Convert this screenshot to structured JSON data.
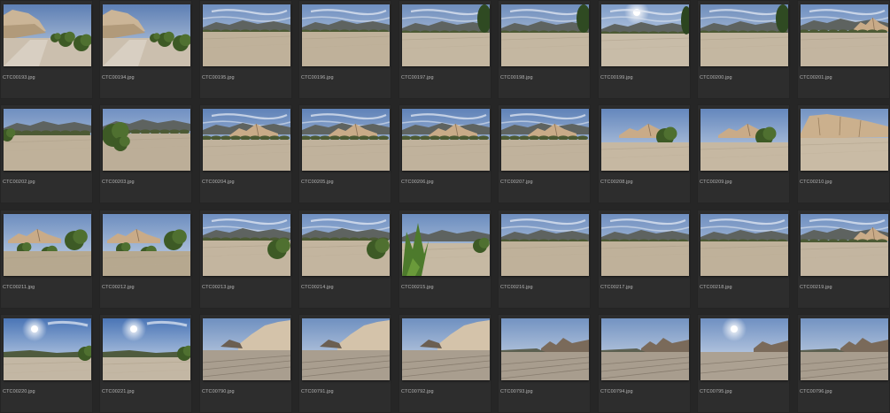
{
  "browser": {
    "thumbnails": [
      {
        "filename": "CTC00193.jpg",
        "scene": "cliffs-trail"
      },
      {
        "filename": "CTC00194.jpg",
        "scene": "cliffs-trail"
      },
      {
        "filename": "CTC00195.jpg",
        "scene": "wash-hills"
      },
      {
        "filename": "CTC00196.jpg",
        "scene": "wash-hills"
      },
      {
        "filename": "CTC00197.jpg",
        "scene": "wash-tree"
      },
      {
        "filename": "CTC00198.jpg",
        "scene": "wash-tree"
      },
      {
        "filename": "CTC00199.jpg",
        "scene": "sun-wash"
      },
      {
        "filename": "CTC00200.jpg",
        "scene": "wash-tree"
      },
      {
        "filename": "CTC00201.jpg",
        "scene": "wash-rocks-right"
      },
      {
        "filename": "CTC00202.jpg",
        "scene": "wash-shrubs"
      },
      {
        "filename": "CTC00203.jpg",
        "scene": "wash-bush-left"
      },
      {
        "filename": "CTC00204.jpg",
        "scene": "rocks-center"
      },
      {
        "filename": "CTC00205.jpg",
        "scene": "rocks-center"
      },
      {
        "filename": "CTC00206.jpg",
        "scene": "rocks-center"
      },
      {
        "filename": "CTC00207.jpg",
        "scene": "rocks-center"
      },
      {
        "filename": "CTC00208.jpg",
        "scene": "rocks-bush"
      },
      {
        "filename": "CTC00209.jpg",
        "scene": "rocks-bush"
      },
      {
        "filename": "CTC00210.jpg",
        "scene": "cliffs-wide"
      },
      {
        "filename": "CTC00211.jpg",
        "scene": "rocks-brush"
      },
      {
        "filename": "CTC00212.jpg",
        "scene": "rocks-brush"
      },
      {
        "filename": "CTC00213.jpg",
        "scene": "wash-bush-right"
      },
      {
        "filename": "CTC00214.jpg",
        "scene": "wash-bush-right"
      },
      {
        "filename": "CTC00215.jpg",
        "scene": "leaves-closeup"
      },
      {
        "filename": "CTC00216.jpg",
        "scene": "wash-hills"
      },
      {
        "filename": "CTC00217.jpg",
        "scene": "wash-hills"
      },
      {
        "filename": "CTC00218.jpg",
        "scene": "wash-hills"
      },
      {
        "filename": "CTC00219.jpg",
        "scene": "wash-rocks-right"
      },
      {
        "filename": "CTC00220.jpg",
        "scene": "sun-sky"
      },
      {
        "filename": "CTC00221.jpg",
        "scene": "sun-sky"
      },
      {
        "filename": "CTC00790.jpg",
        "scene": "tracks-cliff"
      },
      {
        "filename": "CTC00791.jpg",
        "scene": "tracks-cliff"
      },
      {
        "filename": "CTC00792.jpg",
        "scene": "tracks-cliff"
      },
      {
        "filename": "CTC00793.jpg",
        "scene": "tracks-rocks"
      },
      {
        "filename": "CTC00794.jpg",
        "scene": "tracks-rocks"
      },
      {
        "filename": "CTC00795.jpg",
        "scene": "tracks-sun"
      },
      {
        "filename": "CTC00796.jpg",
        "scene": "tracks-rocks"
      }
    ]
  }
}
